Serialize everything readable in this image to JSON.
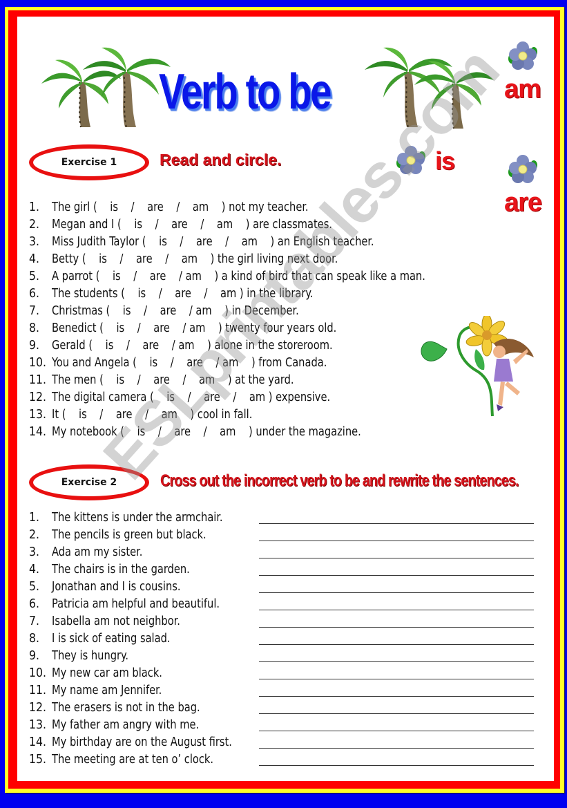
{
  "colors": {
    "outer_border": "#0000f0",
    "middle_border": "#ffff2a",
    "inner_border": "#ff0000",
    "title": "#0a17e8",
    "accent_red": "#e8141a"
  },
  "header": {
    "title": "Verb to be",
    "decor_words": [
      "am",
      "is",
      "are"
    ]
  },
  "exercise1": {
    "label": "Exercise 1",
    "instruction": "Read and circle.",
    "items": [
      {
        "num": "1.",
        "text": "The girl (    is    /    are    /    am    ) not my teacher."
      },
      {
        "num": "2.",
        "text": "Megan and I (    is    /    are    /    am    ) are classmates."
      },
      {
        "num": "3.",
        "text": "Miss Judith Taylor (    is    /    are    /    am    ) an English teacher."
      },
      {
        "num": "4.",
        "text": "Betty (    is    /    are    /    am    ) the girl living next door."
      },
      {
        "num": "5.",
        "text": "A parrot (    is    /    are    / am    ) a kind of bird that can speak like a man."
      },
      {
        "num": "6.",
        "text": "The students (    is    /    are    /    am ) in the library."
      },
      {
        "num": "7.",
        "text": "Christmas (    is    /    are    / am    ) in December."
      },
      {
        "num": "8.",
        "text": "Benedict (    is    /    are    / am    ) twenty four years old."
      },
      {
        "num": "9.",
        "text": "Gerald (    is    /    are    / am    ) alone in the storeroom."
      },
      {
        "num": "10.",
        "text": "You and Angela (    is    /    are    / am    ) from Canada."
      },
      {
        "num": "11.",
        "text": "The men (    is    /    are    /    am    ) at the yard."
      },
      {
        "num": "12.",
        "text": "The digital camera (    is    /    are    /    am ) expensive."
      },
      {
        "num": "13.",
        "text": "It (    is    /    are    /    am    ) cool in fall."
      },
      {
        "num": "14.",
        "text": "My notebook (    is    /    are    /    am    ) under the magazine."
      }
    ]
  },
  "exercise2": {
    "label": "Exercise 2",
    "instruction": "Cross out the incorrect verb to be and rewrite the sentences.",
    "items": [
      {
        "num": "1.",
        "text": "The kittens is under the armchair."
      },
      {
        "num": "2.",
        "text": "The pencils is green but black."
      },
      {
        "num": "3.",
        "text": "Ada am my sister."
      },
      {
        "num": "4.",
        "text": "The chairs is in the garden."
      },
      {
        "num": "5.",
        "text": "Jonathan and I is cousins."
      },
      {
        "num": "6.",
        "text": "Patricia am helpful and beautiful."
      },
      {
        "num": "7.",
        "text": "Isabella am not neighbor."
      },
      {
        "num": "8.",
        "text": "I is sick of eating salad."
      },
      {
        "num": "9.",
        "text": "They is hungry."
      },
      {
        "num": "10.",
        "text": "My new car am black."
      },
      {
        "num": "11.",
        "text": "My name am Jennifer."
      },
      {
        "num": "12.",
        "text": "The erasers is not in the bag."
      },
      {
        "num": "13.",
        "text": "My father am angry with me."
      },
      {
        "num": "14.",
        "text": "My birthday are on the August first."
      },
      {
        "num": "15.",
        "text": "The meeting are at ten o’ clock."
      }
    ]
  },
  "watermark": "ESLprintables.com"
}
